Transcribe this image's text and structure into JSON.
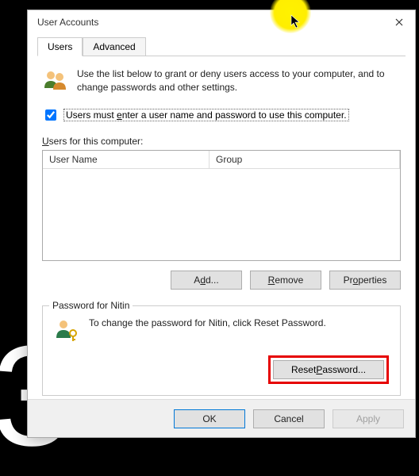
{
  "window": {
    "title": "User Accounts"
  },
  "tabs": {
    "users": "Users",
    "advanced": "Advanced"
  },
  "intro": "Use the list below to grant or deny users access to your computer, and to change passwords and other settings.",
  "checkbox": {
    "label_full": "Users must enter a user name and password to use this computer.",
    "checked": true
  },
  "list": {
    "label": "Users for this computer:",
    "columns": {
      "user": "User Name",
      "group": "Group"
    }
  },
  "buttons": {
    "add": "Add...",
    "remove": "Remove",
    "properties": "Properties"
  },
  "password_section": {
    "heading": "Password for Nitin",
    "text": "To change the password for Nitin, click Reset Password.",
    "reset": "Reset Password..."
  },
  "footer": {
    "ok": "OK",
    "cancel": "Cancel",
    "apply": "Apply"
  }
}
